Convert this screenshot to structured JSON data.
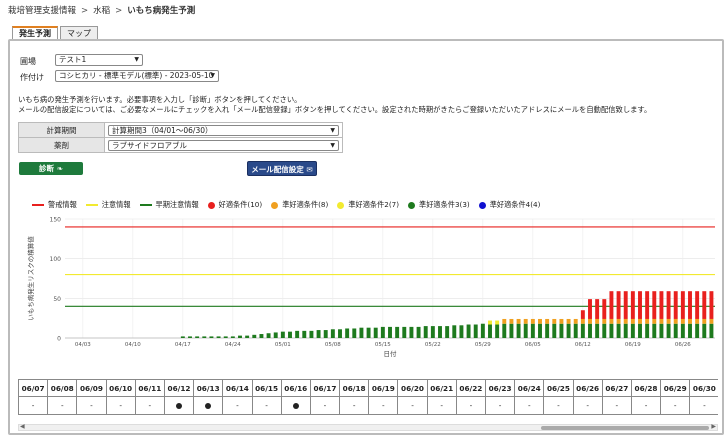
{
  "breadcrumb": [
    "栽培管理支援情報",
    "水稲",
    "いもち病発生予測"
  ],
  "breadcrumb_sep": ">",
  "tabs": [
    {
      "label": "発生予測",
      "active": true
    },
    {
      "label": "マップ",
      "active": false
    }
  ],
  "form": {
    "field_label": "圃場",
    "field_value": "テスト1",
    "crop_label": "作付け",
    "crop_value": "コシヒカリ - 標準モデル(標準) - 2023-05-10"
  },
  "description": [
    "いもち病の発生予測を行います。必要事項を入力し「診断」ボタンを押してください。",
    "メールの配信設定については、ご必要なメールにチェックを入れ「メール配信登録」ボタンを押してください。設定された時期がきたらご登録いただいたアドレスにメールを自動配信致します。"
  ],
  "settings": {
    "period_label": "計算期間",
    "period_value": "計算期間3（04/01～06/30）",
    "drug_label": "薬剤",
    "drug_value": "ラブサイドフロアブル"
  },
  "buttons": {
    "diagnose": "診断",
    "mail": "メール配信設定"
  },
  "colors": {
    "red": "#e8201e",
    "yellow": "#f2ea30",
    "green": "#1e7a1e",
    "orange": "#f0a020",
    "blue": "#1010d0",
    "btn_green": "#1e7a3c",
    "btn_blue": "#2a4a8a"
  },
  "chart_data": {
    "type": "bar",
    "ylabel": "いもち病発生リスクの積算値",
    "xlabel": "日付",
    "ylim": [
      0,
      150
    ],
    "yticks": [
      0,
      50,
      100,
      150
    ],
    "grid": true,
    "legend_position": "top",
    "xticks": [
      "04/03",
      "04/10",
      "04/17",
      "04/24",
      "05/01",
      "05/08",
      "05/15",
      "05/22",
      "05/29",
      "06/05",
      "06/12",
      "06/19",
      "06/26"
    ],
    "date_range": [
      "04/01",
      "06/30"
    ],
    "series_lines": [
      {
        "name": "警戒情報",
        "value": 140,
        "color": "#e8201e"
      },
      {
        "name": "注意情報",
        "value": 80,
        "color": "#f2ea30"
      },
      {
        "name": "早期注意情報",
        "value": 40,
        "color": "#1e7a1e"
      }
    ],
    "series_bars": [
      {
        "name": "好適条件(10)",
        "color": "#e8201e"
      },
      {
        "name": "準好適条件(8)",
        "color": "#f0a020"
      },
      {
        "name": "準好適条件2(7)",
        "color": "#f2ea30"
      },
      {
        "name": "準好適条件3(3)",
        "color": "#1e7a1e"
      },
      {
        "name": "準好適条件4(4)",
        "color": "#1010d0"
      }
    ],
    "bars": [
      {
        "date": "04/17",
        "values": [
          0,
          0,
          0,
          2,
          0
        ]
      },
      {
        "date": "04/18",
        "values": [
          0,
          0,
          0,
          2,
          0
        ]
      },
      {
        "date": "04/19",
        "values": [
          0,
          0,
          0,
          2,
          0
        ]
      },
      {
        "date": "04/20",
        "values": [
          0,
          0,
          0,
          2,
          0
        ]
      },
      {
        "date": "04/21",
        "values": [
          0,
          0,
          0,
          2,
          0
        ]
      },
      {
        "date": "04/22",
        "values": [
          0,
          0,
          0,
          2,
          0
        ]
      },
      {
        "date": "04/23",
        "values": [
          0,
          0,
          0,
          2,
          0
        ]
      },
      {
        "date": "04/24",
        "values": [
          0,
          0,
          0,
          2,
          0
        ]
      },
      {
        "date": "04/25",
        "values": [
          0,
          0,
          0,
          3,
          0
        ]
      },
      {
        "date": "04/26",
        "values": [
          0,
          0,
          0,
          3,
          0
        ]
      },
      {
        "date": "04/27",
        "values": [
          0,
          0,
          0,
          4,
          0
        ]
      },
      {
        "date": "04/28",
        "values": [
          0,
          0,
          0,
          5,
          0
        ]
      },
      {
        "date": "04/29",
        "values": [
          0,
          0,
          0,
          6,
          0
        ]
      },
      {
        "date": "04/30",
        "values": [
          0,
          0,
          0,
          7,
          0
        ]
      },
      {
        "date": "05/01",
        "values": [
          0,
          0,
          0,
          8,
          0
        ]
      },
      {
        "date": "05/02",
        "values": [
          0,
          0,
          0,
          8,
          0
        ]
      },
      {
        "date": "05/03",
        "values": [
          0,
          0,
          0,
          9,
          0
        ]
      },
      {
        "date": "05/04",
        "values": [
          0,
          0,
          0,
          9,
          0
        ]
      },
      {
        "date": "05/05",
        "values": [
          0,
          0,
          0,
          9,
          0
        ]
      },
      {
        "date": "05/06",
        "values": [
          0,
          0,
          0,
          10,
          0
        ]
      },
      {
        "date": "05/07",
        "values": [
          0,
          0,
          0,
          10,
          0
        ]
      },
      {
        "date": "05/08",
        "values": [
          0,
          0,
          0,
          11,
          0
        ]
      },
      {
        "date": "05/09",
        "values": [
          0,
          0,
          0,
          11,
          0
        ]
      },
      {
        "date": "05/10",
        "values": [
          0,
          0,
          0,
          12,
          0
        ]
      },
      {
        "date": "05/11",
        "values": [
          0,
          0,
          0,
          12,
          0
        ]
      },
      {
        "date": "05/12",
        "values": [
          0,
          0,
          0,
          13,
          0
        ]
      },
      {
        "date": "05/13",
        "values": [
          0,
          0,
          0,
          13,
          0
        ]
      },
      {
        "date": "05/14",
        "values": [
          0,
          0,
          0,
          13,
          0
        ]
      },
      {
        "date": "05/15",
        "values": [
          0,
          0,
          0,
          14,
          0
        ]
      },
      {
        "date": "05/16",
        "values": [
          0,
          0,
          0,
          14,
          0
        ]
      },
      {
        "date": "05/17",
        "values": [
          0,
          0,
          0,
          14,
          0
        ]
      },
      {
        "date": "05/18",
        "values": [
          0,
          0,
          0,
          14,
          0
        ]
      },
      {
        "date": "05/19",
        "values": [
          0,
          0,
          0,
          14,
          0
        ]
      },
      {
        "date": "05/20",
        "values": [
          0,
          0,
          0,
          14,
          0
        ]
      },
      {
        "date": "05/21",
        "values": [
          0,
          0,
          0,
          15,
          0
        ]
      },
      {
        "date": "05/22",
        "values": [
          0,
          0,
          0,
          15,
          0
        ]
      },
      {
        "date": "05/23",
        "values": [
          0,
          0,
          0,
          15,
          0
        ]
      },
      {
        "date": "05/24",
        "values": [
          0,
          0,
          0,
          15,
          0
        ]
      },
      {
        "date": "05/25",
        "values": [
          0,
          0,
          0,
          16,
          0
        ]
      },
      {
        "date": "05/26",
        "values": [
          0,
          0,
          0,
          16,
          0
        ]
      },
      {
        "date": "05/27",
        "values": [
          0,
          0,
          0,
          17,
          0
        ]
      },
      {
        "date": "05/28",
        "values": [
          0,
          0,
          0,
          17,
          0
        ]
      },
      {
        "date": "05/29",
        "values": [
          0,
          0,
          0,
          18,
          0
        ]
      },
      {
        "date": "05/30",
        "values": [
          0,
          0,
          5,
          17,
          0
        ]
      },
      {
        "date": "05/31",
        "values": [
          0,
          0,
          5,
          17,
          0
        ]
      },
      {
        "date": "06/01",
        "values": [
          0,
          6,
          0,
          18,
          0
        ]
      },
      {
        "date": "06/02",
        "values": [
          0,
          6,
          0,
          18,
          0
        ]
      },
      {
        "date": "06/03",
        "values": [
          0,
          6,
          0,
          18,
          0
        ]
      },
      {
        "date": "06/04",
        "values": [
          0,
          6,
          0,
          18,
          0
        ]
      },
      {
        "date": "06/05",
        "values": [
          0,
          6,
          0,
          18,
          0
        ]
      },
      {
        "date": "06/06",
        "values": [
          0,
          6,
          0,
          18,
          0
        ]
      },
      {
        "date": "06/07",
        "values": [
          0,
          6,
          0,
          18,
          0
        ]
      },
      {
        "date": "06/08",
        "values": [
          0,
          6,
          0,
          18,
          0
        ]
      },
      {
        "date": "06/09",
        "values": [
          0,
          6,
          0,
          18,
          0
        ]
      },
      {
        "date": "06/10",
        "values": [
          0,
          6,
          0,
          18,
          0
        ]
      },
      {
        "date": "06/11",
        "values": [
          0,
          6,
          0,
          18,
          0
        ]
      },
      {
        "date": "06/12",
        "values": [
          11,
          6,
          0,
          18,
          0
        ]
      },
      {
        "date": "06/13",
        "values": [
          25,
          6,
          0,
          18,
          0
        ]
      },
      {
        "date": "06/14",
        "values": [
          25,
          6,
          0,
          18,
          0
        ]
      },
      {
        "date": "06/15",
        "values": [
          25,
          6,
          0,
          18,
          0
        ]
      },
      {
        "date": "06/16",
        "values": [
          35,
          6,
          0,
          18,
          0
        ]
      },
      {
        "date": "06/17",
        "values": [
          35,
          6,
          0,
          18,
          0
        ]
      },
      {
        "date": "06/18",
        "values": [
          35,
          6,
          0,
          18,
          0
        ]
      },
      {
        "date": "06/19",
        "values": [
          35,
          6,
          0,
          18,
          0
        ]
      },
      {
        "date": "06/20",
        "values": [
          35,
          6,
          0,
          18,
          0
        ]
      },
      {
        "date": "06/21",
        "values": [
          35,
          6,
          0,
          18,
          0
        ]
      },
      {
        "date": "06/22",
        "values": [
          35,
          6,
          0,
          18,
          0
        ]
      },
      {
        "date": "06/23",
        "values": [
          35,
          6,
          0,
          18,
          0
        ]
      },
      {
        "date": "06/24",
        "values": [
          35,
          6,
          0,
          18,
          0
        ]
      },
      {
        "date": "06/25",
        "values": [
          35,
          6,
          0,
          18,
          0
        ]
      },
      {
        "date": "06/26",
        "values": [
          35,
          6,
          0,
          18,
          0
        ]
      },
      {
        "date": "06/27",
        "values": [
          35,
          6,
          0,
          18,
          0
        ]
      },
      {
        "date": "06/28",
        "values": [
          35,
          6,
          0,
          18,
          0
        ]
      },
      {
        "date": "06/29",
        "values": [
          35,
          6,
          0,
          18,
          0
        ]
      },
      {
        "date": "06/30",
        "values": [
          35,
          6,
          0,
          18,
          0
        ]
      }
    ]
  },
  "table": {
    "dates": [
      "06/07",
      "06/08",
      "06/09",
      "06/10",
      "06/11",
      "06/12",
      "06/13",
      "06/14",
      "06/15",
      "06/16",
      "06/17",
      "06/18",
      "06/19",
      "06/20",
      "06/21",
      "06/22",
      "06/23",
      "06/24",
      "06/25",
      "06/26",
      "06/27",
      "06/28",
      "06/29",
      "06/30"
    ],
    "values": [
      "-",
      "-",
      "-",
      "-",
      "-",
      "●",
      "●",
      "-",
      "-",
      "●",
      "-",
      "-",
      "-",
      "-",
      "-",
      "-",
      "-",
      "-",
      "-",
      "-",
      "-",
      "-",
      "-",
      "-"
    ]
  }
}
